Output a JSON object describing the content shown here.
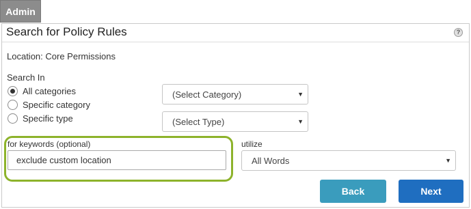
{
  "admin_tab": {
    "label": "Admin"
  },
  "header": {
    "title": "Search for Policy Rules",
    "help_icon": "question-mark-icon",
    "help_glyph": "?"
  },
  "location": {
    "text": "Location: Core Permissions"
  },
  "search_in": {
    "label": "Search In",
    "options": [
      {
        "label": "All categories",
        "selected": true
      },
      {
        "label": "Specific category",
        "selected": false
      },
      {
        "label": "Specific type",
        "selected": false
      }
    ],
    "category_select": {
      "value": "(Select Category)"
    },
    "type_select": {
      "value": "(Select Type)"
    }
  },
  "keywords": {
    "label": "for keywords (optional)",
    "value": "exclude custom location"
  },
  "utilize": {
    "label": "utilize",
    "value": "All Words"
  },
  "buttons": {
    "back": "Back",
    "next": "Next"
  },
  "colors": {
    "admin_tab": "#8c8c8c",
    "back_button": "#3a9cbd",
    "next_button": "#1f6ec0",
    "highlight": "#8db32b"
  }
}
